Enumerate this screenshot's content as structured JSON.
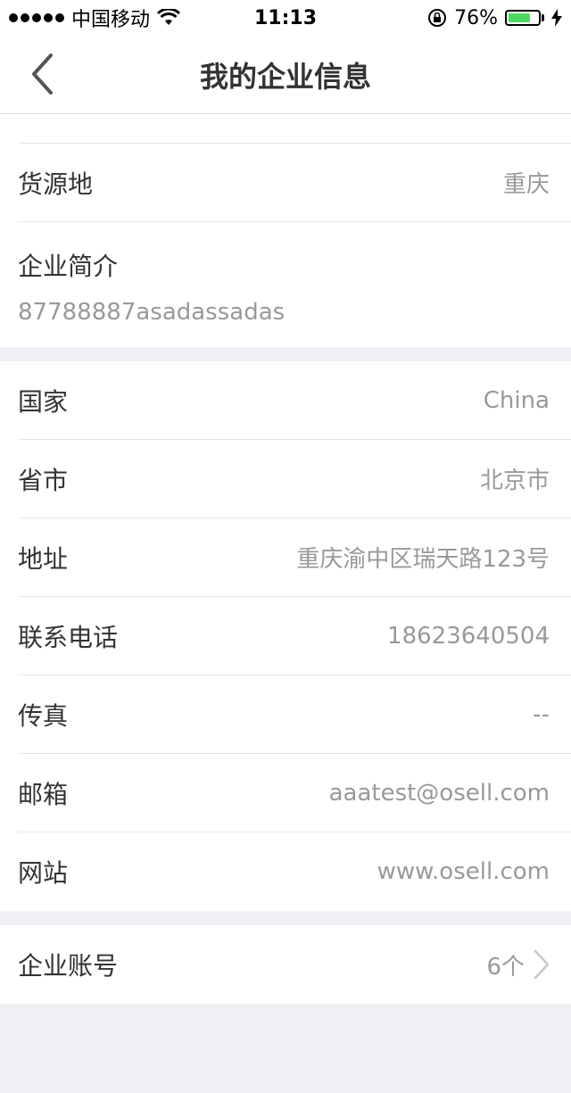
{
  "status_bar": {
    "carrier": "中国移动",
    "time": "11:13",
    "battery_percent": "76%",
    "battery_level": 0.76,
    "battery_color": "#4cd964"
  },
  "nav": {
    "title": "我的企业信息",
    "back_icon": "chevron-left-icon"
  },
  "section1": {
    "source": {
      "label": "货源地",
      "value": "重庆"
    },
    "intro": {
      "label": "企业简介",
      "value": "87788887asadassadas"
    }
  },
  "section2": {
    "rows": [
      {
        "label": "国家",
        "value": "China"
      },
      {
        "label": "省市",
        "value": "北京市"
      },
      {
        "label": "地址",
        "value": "重庆渝中区瑞天路123号"
      },
      {
        "label": "联系电话",
        "value": "18623640504"
      },
      {
        "label": "传真",
        "value": "--"
      },
      {
        "label": "邮箱",
        "value": "aaatest@osell.com"
      },
      {
        "label": "网站",
        "value": "www.osell.com"
      }
    ]
  },
  "section3": {
    "account": {
      "label": "企业账号",
      "value": "6个"
    }
  }
}
